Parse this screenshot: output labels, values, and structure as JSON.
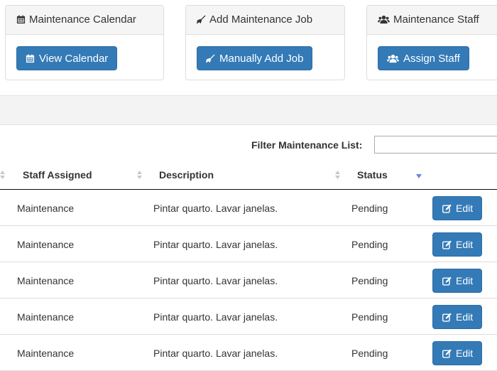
{
  "panels": [
    {
      "title": "Maintenance Calendar",
      "title_icon": "calendar-icon",
      "button_label": "View Calendar",
      "button_icon": "calendar-icon"
    },
    {
      "title": "Add Maintenance Job",
      "title_icon": "broom-icon",
      "button_label": "Manually Add Job",
      "button_icon": "broom-icon"
    },
    {
      "title": "Maintenance Staff",
      "title_icon": "users-icon",
      "button_label": "Assign Staff",
      "button_icon": "users-icon"
    }
  ],
  "filter": {
    "label": "Filter Maintenance List:",
    "value": "",
    "placeholder": ""
  },
  "table": {
    "columns": [
      "Staff Assigned",
      "Description",
      "Status"
    ],
    "rows": [
      {
        "staff": "Maintenance",
        "description": "Pintar quarto. Lavar janelas.",
        "status": "Pending",
        "action": "Edit"
      },
      {
        "staff": "Maintenance",
        "description": "Pintar quarto. Lavar janelas.",
        "status": "Pending",
        "action": "Edit"
      },
      {
        "staff": "Maintenance",
        "description": "Pintar quarto. Lavar janelas.",
        "status": "Pending",
        "action": "Edit"
      },
      {
        "staff": "Maintenance",
        "description": "Pintar quarto. Lavar janelas.",
        "status": "Pending",
        "action": "Edit"
      },
      {
        "staff": "Maintenance",
        "description": "Pintar quarto. Lavar janelas.",
        "status": "Pending",
        "action": "Edit"
      }
    ]
  },
  "colors": {
    "primary": "#337ab7",
    "sort_active": "#6f86d6"
  }
}
